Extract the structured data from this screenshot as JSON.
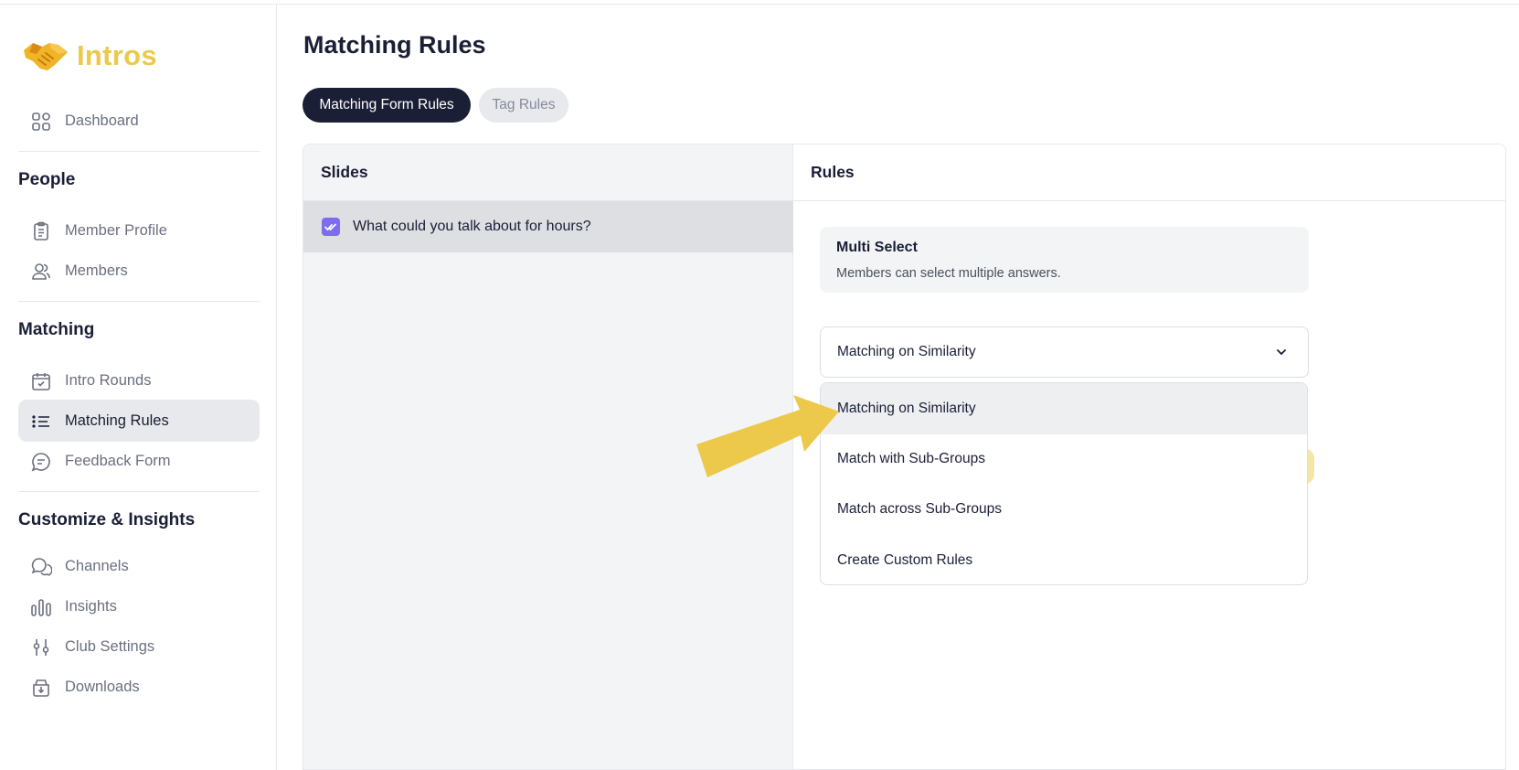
{
  "app": {
    "name": "Intros"
  },
  "sidebar": {
    "dashboard": {
      "label": "Dashboard",
      "icon": "dashboard-grid-icon"
    },
    "sections": [
      {
        "title": "People",
        "items": [
          {
            "label": "Member Profile",
            "icon": "clipboard-icon"
          },
          {
            "label": "Members",
            "icon": "users-icon"
          }
        ]
      },
      {
        "title": "Matching",
        "items": [
          {
            "label": "Intro Rounds",
            "icon": "calendar-check-icon"
          },
          {
            "label": "Matching Rules",
            "icon": "list-icon",
            "active": true
          },
          {
            "label": "Feedback Form",
            "icon": "message-icon"
          }
        ]
      },
      {
        "title": "Customize & Insights",
        "items": [
          {
            "label": "Channels",
            "icon": "chat-bubbles-icon"
          },
          {
            "label": "Insights",
            "icon": "bar-chart-icon"
          },
          {
            "label": "Club Settings",
            "icon": "sliders-icon"
          },
          {
            "label": "Downloads",
            "icon": "download-box-icon"
          }
        ]
      }
    ]
  },
  "main": {
    "title": "Matching Rules",
    "tabs": [
      {
        "label": "Matching Form Rules",
        "active": true
      },
      {
        "label": "Tag Rules",
        "active": false
      }
    ],
    "slides": {
      "header": "Slides",
      "items": [
        {
          "label": "What could you talk about for hours?",
          "checked": true
        }
      ]
    },
    "rules": {
      "header": "Rules",
      "info_card": {
        "title": "Multi Select",
        "description": "Members can select multiple answers."
      },
      "select": {
        "value": "Matching on Similarity",
        "options": [
          "Matching on Similarity",
          "Match with Sub-Groups",
          "Match across Sub-Groups",
          "Create Custom Rules"
        ],
        "highlighted_index": 0
      }
    }
  },
  "colors": {
    "brand_yellow": "#ecc94b",
    "dark_navy": "#1a1f36",
    "checkbox_purple": "#7c6cf0",
    "pointer_arrow": "#ecc94b"
  }
}
